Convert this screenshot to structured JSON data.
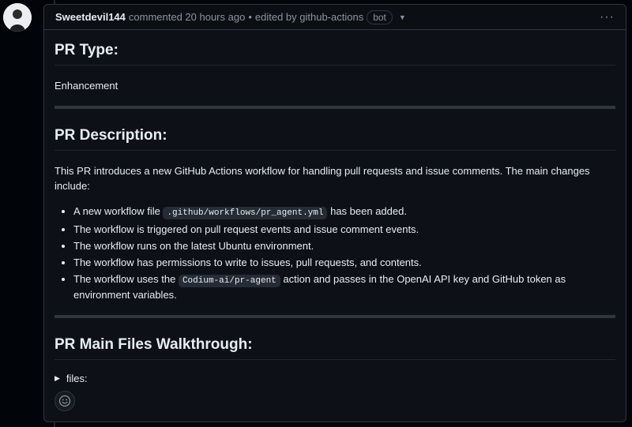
{
  "header": {
    "author": "Sweetdevil144",
    "action": "commented 20 hours ago",
    "separator": "•",
    "edited": "edited by github-actions",
    "badge": "bot"
  },
  "body": {
    "type_heading": "PR Type:",
    "type_value": "Enhancement",
    "description_heading": "PR Description:",
    "description_text": "This PR introduces a new GitHub Actions workflow for handling pull requests and issue comments. The main changes include:",
    "bullets": [
      {
        "before": "A new workflow file ",
        "code": ".github/workflows/pr_agent.yml",
        "after": " has been added."
      },
      {
        "text": "The workflow is triggered on pull request events and issue comment events."
      },
      {
        "text": "The workflow runs on the latest Ubuntu environment."
      },
      {
        "text": "The workflow has permissions to write to issues, pull requests, and contents."
      },
      {
        "before": "The workflow uses the ",
        "code": "Codium-ai/pr-agent",
        "after": " action and passes in the OpenAI API key and GitHub token as environment variables."
      }
    ],
    "walkthrough_heading": "PR Main Files Walkthrough:",
    "files_summary": "files:"
  },
  "icons": {
    "more": "kebab-horizontal-icon",
    "reaction": "smiley-icon",
    "expand": "triangle-right-icon"
  }
}
